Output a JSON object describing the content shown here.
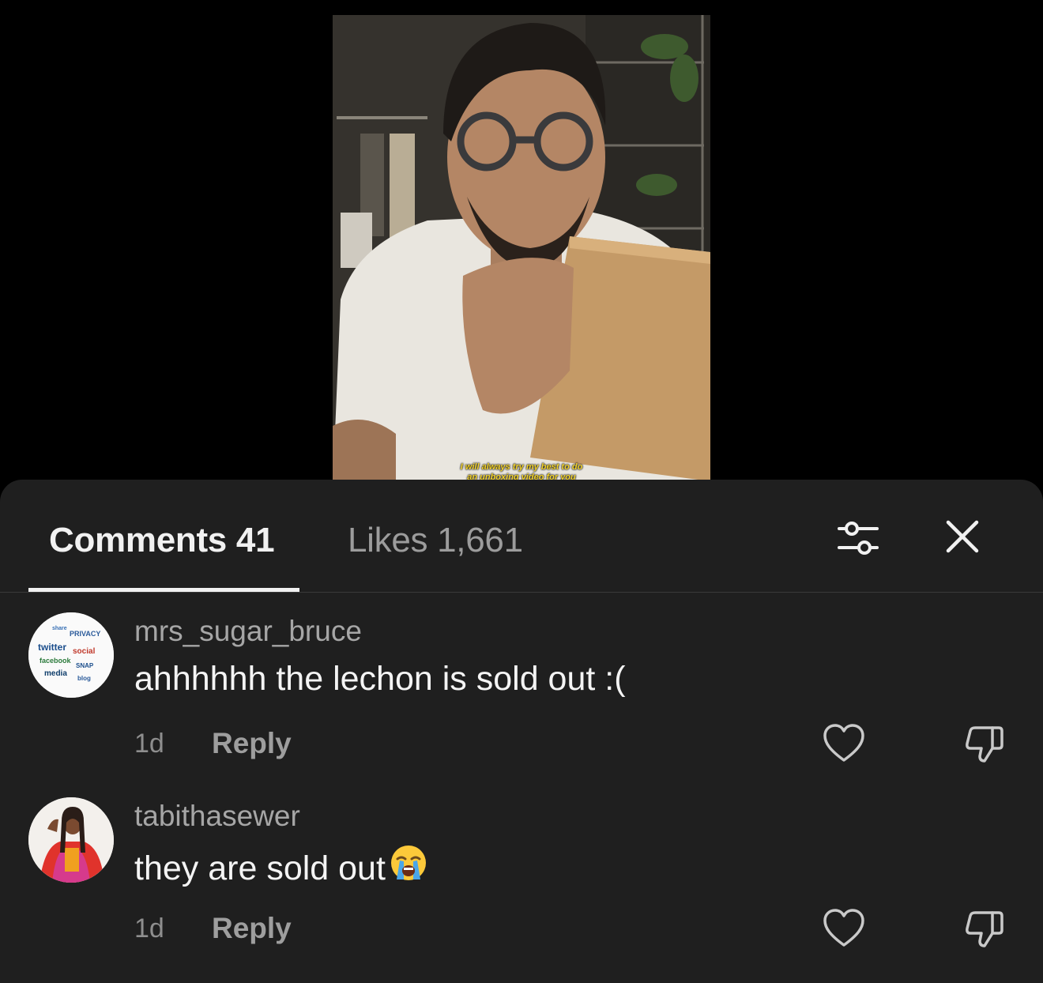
{
  "video": {
    "caption_line1": "I will always try my best to do",
    "caption_line2": "an unboxing video for you"
  },
  "tabs": [
    {
      "label": "Comments 41",
      "active": true
    },
    {
      "label": "Likes 1,661",
      "active": false
    }
  ],
  "header_icons": {
    "filter": "sliders-icon",
    "close": "close-icon"
  },
  "comments": [
    {
      "username": "mrs_sugar_bruce",
      "text": "ahhhhhh the lechon is sold out :(",
      "time": "1d",
      "reply_label": "Reply",
      "avatar": "word-cloud-avatar"
    },
    {
      "username": "tabithasewer",
      "text": "they are sold out",
      "emoji": "loudly-crying-face-emoji",
      "time": "1d",
      "reply_label": "Reply",
      "avatar": "person-photo-avatar"
    }
  ],
  "colors": {
    "sheet_bg": "#1f1f1f",
    "active_tab": "#f1f1f1",
    "inactive_tab": "#9c9c9c",
    "caption": "#f2d22b"
  }
}
